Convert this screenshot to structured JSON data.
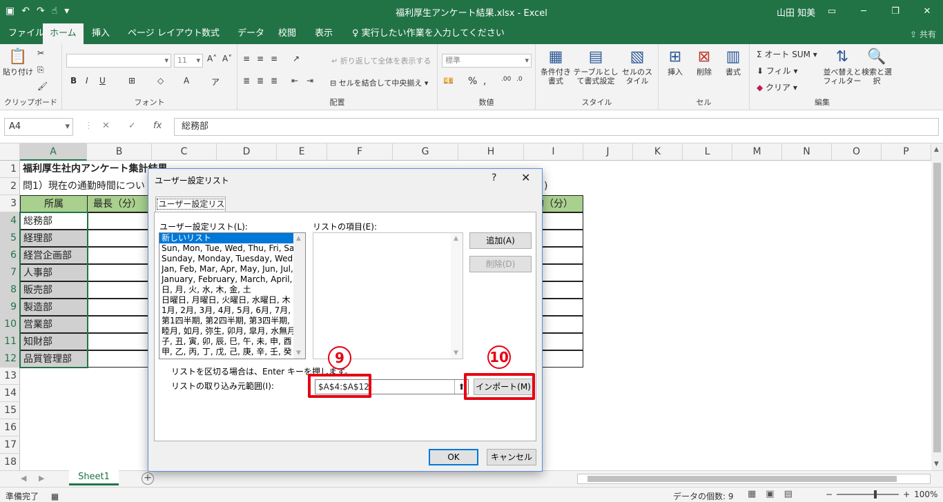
{
  "window": {
    "title": "福利厚生アンケート結果.xlsx - Excel",
    "user": "山田 知美"
  },
  "tabs": [
    "ファイル",
    "ホーム",
    "挿入",
    "ページ レイアウト",
    "数式",
    "データ",
    "校閲",
    "表示"
  ],
  "tell_me": "実行したい作業を入力してください",
  "share": "共有",
  "ribbon": {
    "clipboard": {
      "label": "クリップボード",
      "paste": "貼り付け"
    },
    "font": {
      "label": "フォント",
      "size": "11"
    },
    "alignment": {
      "label": "配置",
      "wrap": "折り返して全体を表示する",
      "merge": "セルを結合して中央揃え"
    },
    "number": {
      "label": "数値",
      "format": "標準"
    },
    "styles": {
      "label": "スタイル",
      "conditional": "条件付き書式",
      "table": "テーブルとして書式設定",
      "cell": "セルのスタイル"
    },
    "cells": {
      "label": "セル",
      "insert": "挿入",
      "delete": "削除",
      "format": "書式"
    },
    "editing": {
      "label": "編集",
      "autosum": "オート SUM",
      "fill": "フィル",
      "clear": "クリア",
      "sort": "並べ替えとフィルター",
      "find": "検索と選択"
    }
  },
  "formula_bar": {
    "name_box": "A4",
    "formula": "総務部"
  },
  "columns": [
    "A",
    "B",
    "C",
    "D",
    "E",
    "F",
    "G",
    "H",
    "I",
    "J",
    "K",
    "L",
    "M",
    "N",
    "O",
    "P"
  ],
  "rows": [
    "1",
    "2",
    "3",
    "4",
    "5",
    "6",
    "7",
    "8",
    "9",
    "10",
    "11",
    "12",
    "13",
    "14",
    "15",
    "16",
    "17",
    "18"
  ],
  "sheet": {
    "a1": "福利厚生社内アンケート集計結果",
    "a2": "問1）現在の通勤時間につい",
    "i2": ")",
    "header_a3": "所属",
    "header_b3": "最長（分）",
    "header_i3": "均（分）",
    "departments": [
      "総務部",
      "経理部",
      "経営企画部",
      "人事部",
      "販売部",
      "製造部",
      "営業部",
      "知財部",
      "品質管理部"
    ]
  },
  "sheet_tab": "Sheet1",
  "status": {
    "ready": "準備完了",
    "count": "データの個数: 9",
    "zoom": "100%"
  },
  "dialog": {
    "title": "ユーザー設定リスト",
    "help": "?",
    "close": "✕",
    "tab": "ユーザー設定リスト",
    "list_label": "ユーザー設定リスト(L):",
    "items_label": "リストの項目(E):",
    "lists": [
      "新しいリスト",
      "Sun, Mon, Tue, Wed, Thu, Fri, Sa",
      "Sunday, Monday, Tuesday, Wedn",
      "Jan, Feb, Mar, Apr, May, Jun, Jul,",
      "January, February, March, April,",
      "日, 月, 火, 水, 木, 金, 土",
      "日曜日, 月曜日, 火曜日, 水曜日, 木",
      "1月, 2月, 3月, 4月, 5月, 6月, 7月, ",
      "第1四半期, 第2四半期, 第3四半期, ",
      "睦月, 如月, 弥生, 卯月, 皐月, 水無月",
      "子, 丑, 寅, 卯, 辰, 巳, 午, 未, 申, 酉",
      "甲, 乙, 丙, 丁, 戊, 己, 庚, 辛, 壬, 癸"
    ],
    "add": "追加(A)",
    "delete": "削除(D)",
    "hint": "リストを区切る場合は、Enter キーを押します。",
    "import_label": "リストの取り込み元範囲(I):",
    "import_range": "$A$4:$A$12",
    "import": "インポート(M)",
    "ok": "OK",
    "cancel": "キャンセル"
  },
  "annotations": {
    "step9": "9",
    "step10": "10"
  },
  "colors": {
    "excel_green": "#217346",
    "header_fill": "#a9d08e",
    "highlight_red": "#e60012"
  }
}
